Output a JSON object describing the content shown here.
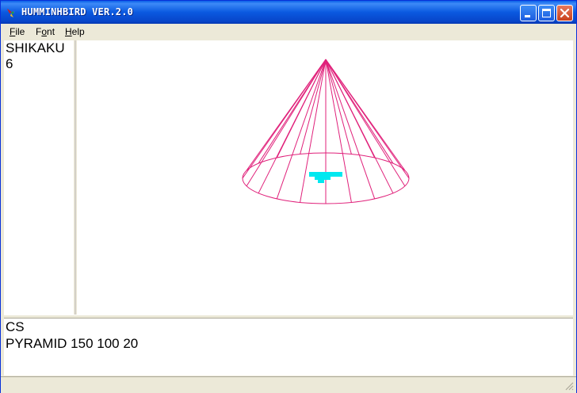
{
  "window": {
    "title": "HUMMINHBIRD VER.2.0"
  },
  "menu": {
    "file": {
      "label": "File",
      "accel": "F",
      "rest": "ile"
    },
    "font": {
      "label": "Font",
      "accel": "o",
      "pre": "F",
      "rest": "nt"
    },
    "help": {
      "label": "Help",
      "accel": "H",
      "rest": "elp"
    }
  },
  "left_pane": {
    "lines": [
      "SHIKAKU",
      "6"
    ]
  },
  "command_pane": {
    "lines": [
      "CS",
      "PYRAMID 150 100 20"
    ]
  },
  "colors": {
    "wireframe": "#e0207a",
    "marker": "#00e8f0"
  }
}
